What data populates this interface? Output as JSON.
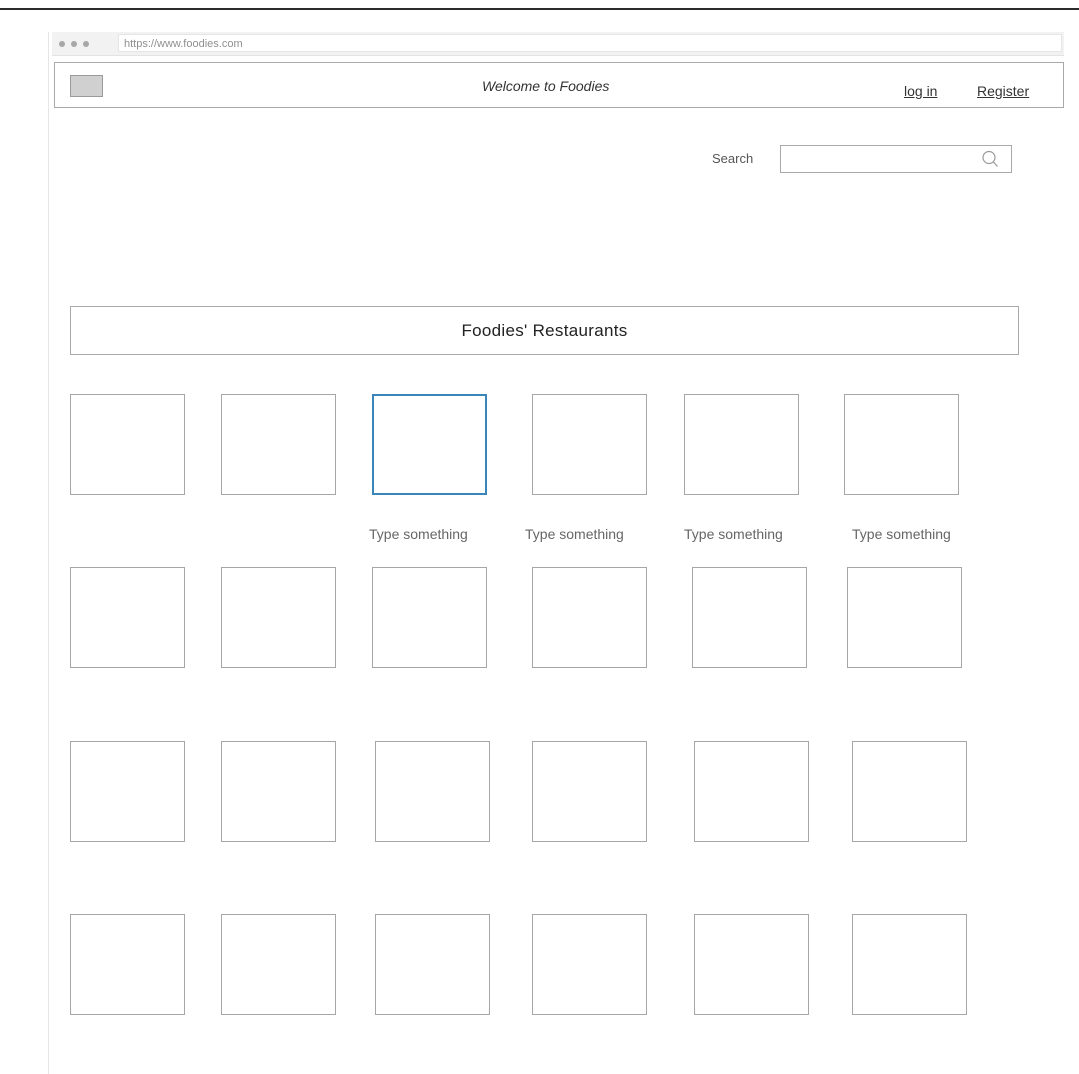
{
  "browser": {
    "url": "https://www.foodies.com"
  },
  "header": {
    "welcome": "Welcome to Foodies",
    "login_label": "log in",
    "register_label": "Register"
  },
  "search": {
    "label": "Search",
    "placeholder": "",
    "value": "",
    "icon": "search-icon"
  },
  "section": {
    "title": "Foodies' Restaurants"
  },
  "grid": {
    "selected_tile": "row 1, column 3",
    "captions": [
      "Type something",
      "Type something",
      "Type something",
      "Type something"
    ]
  },
  "colors": {
    "selection_border": "#3a86b8",
    "placeholder_border": "#a6a6a6"
  }
}
